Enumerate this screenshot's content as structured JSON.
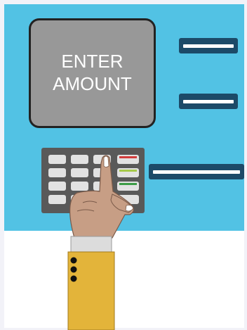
{
  "screen": {
    "line1": "ENTER",
    "line2": "AMOUNT"
  },
  "colors": {
    "panel": "#52c2e4",
    "screen": "#989898",
    "slot": "#1c4a68",
    "keypad": "#595959",
    "key": "#e2e2e2",
    "cancel_key": "#d23c3c",
    "clear_key": "#a6c94a",
    "enter_key": "#3c9c46",
    "sleeve": "#e3b43a",
    "skin": "#c79e85"
  },
  "icons": {
    "keypad": "keypad-icon",
    "hand": "pointing-hand-icon"
  }
}
